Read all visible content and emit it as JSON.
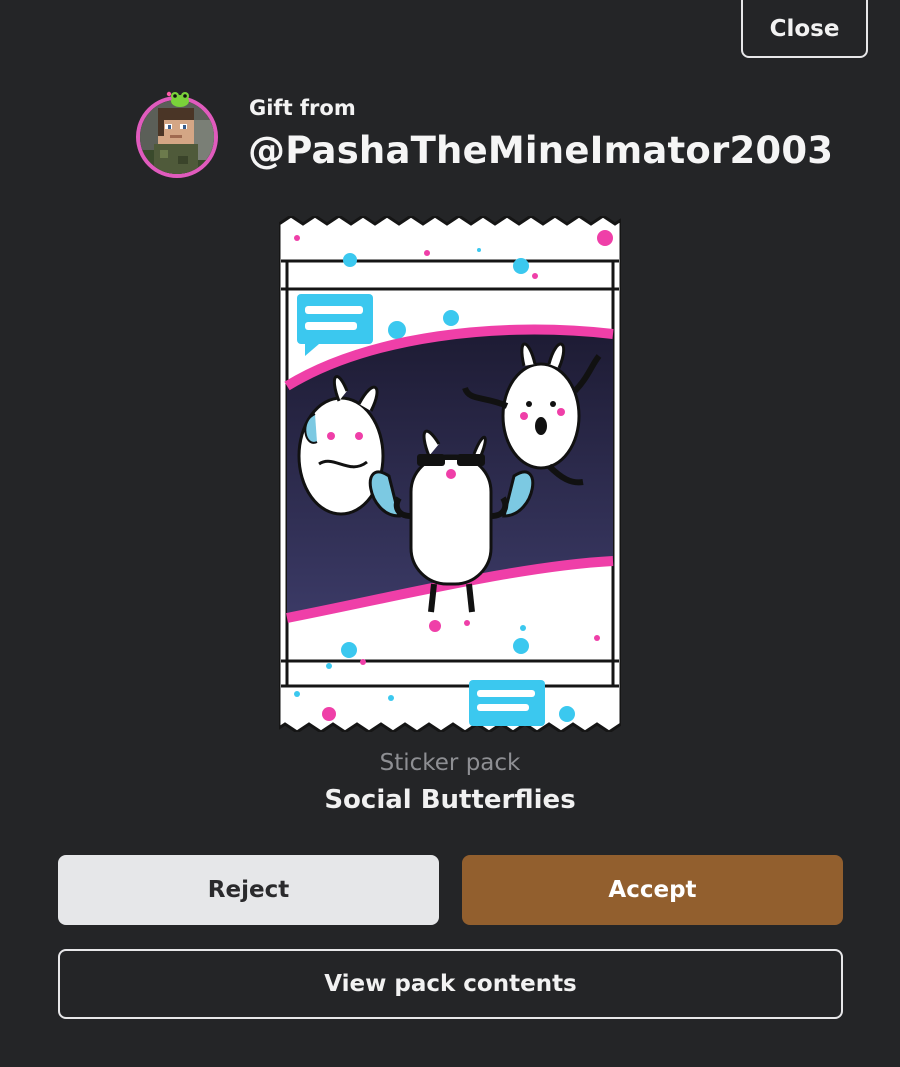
{
  "header": {
    "close_label": "Close"
  },
  "gift": {
    "from_label": "Gift from",
    "sender": "@PashaTheMineImator2003"
  },
  "pack": {
    "type_label": "Sticker pack",
    "name": "Social Butterflies"
  },
  "actions": {
    "reject_label": "Reject",
    "accept_label": "Accept",
    "view_label": "View pack contents"
  },
  "colors": {
    "background": "#242527",
    "accept": "#925f2e",
    "reject": "#e6e7e9",
    "avatar_ring": "#e05bbd",
    "pack_pink": "#ef3fa8",
    "pack_cyan": "#3bc8ef"
  }
}
